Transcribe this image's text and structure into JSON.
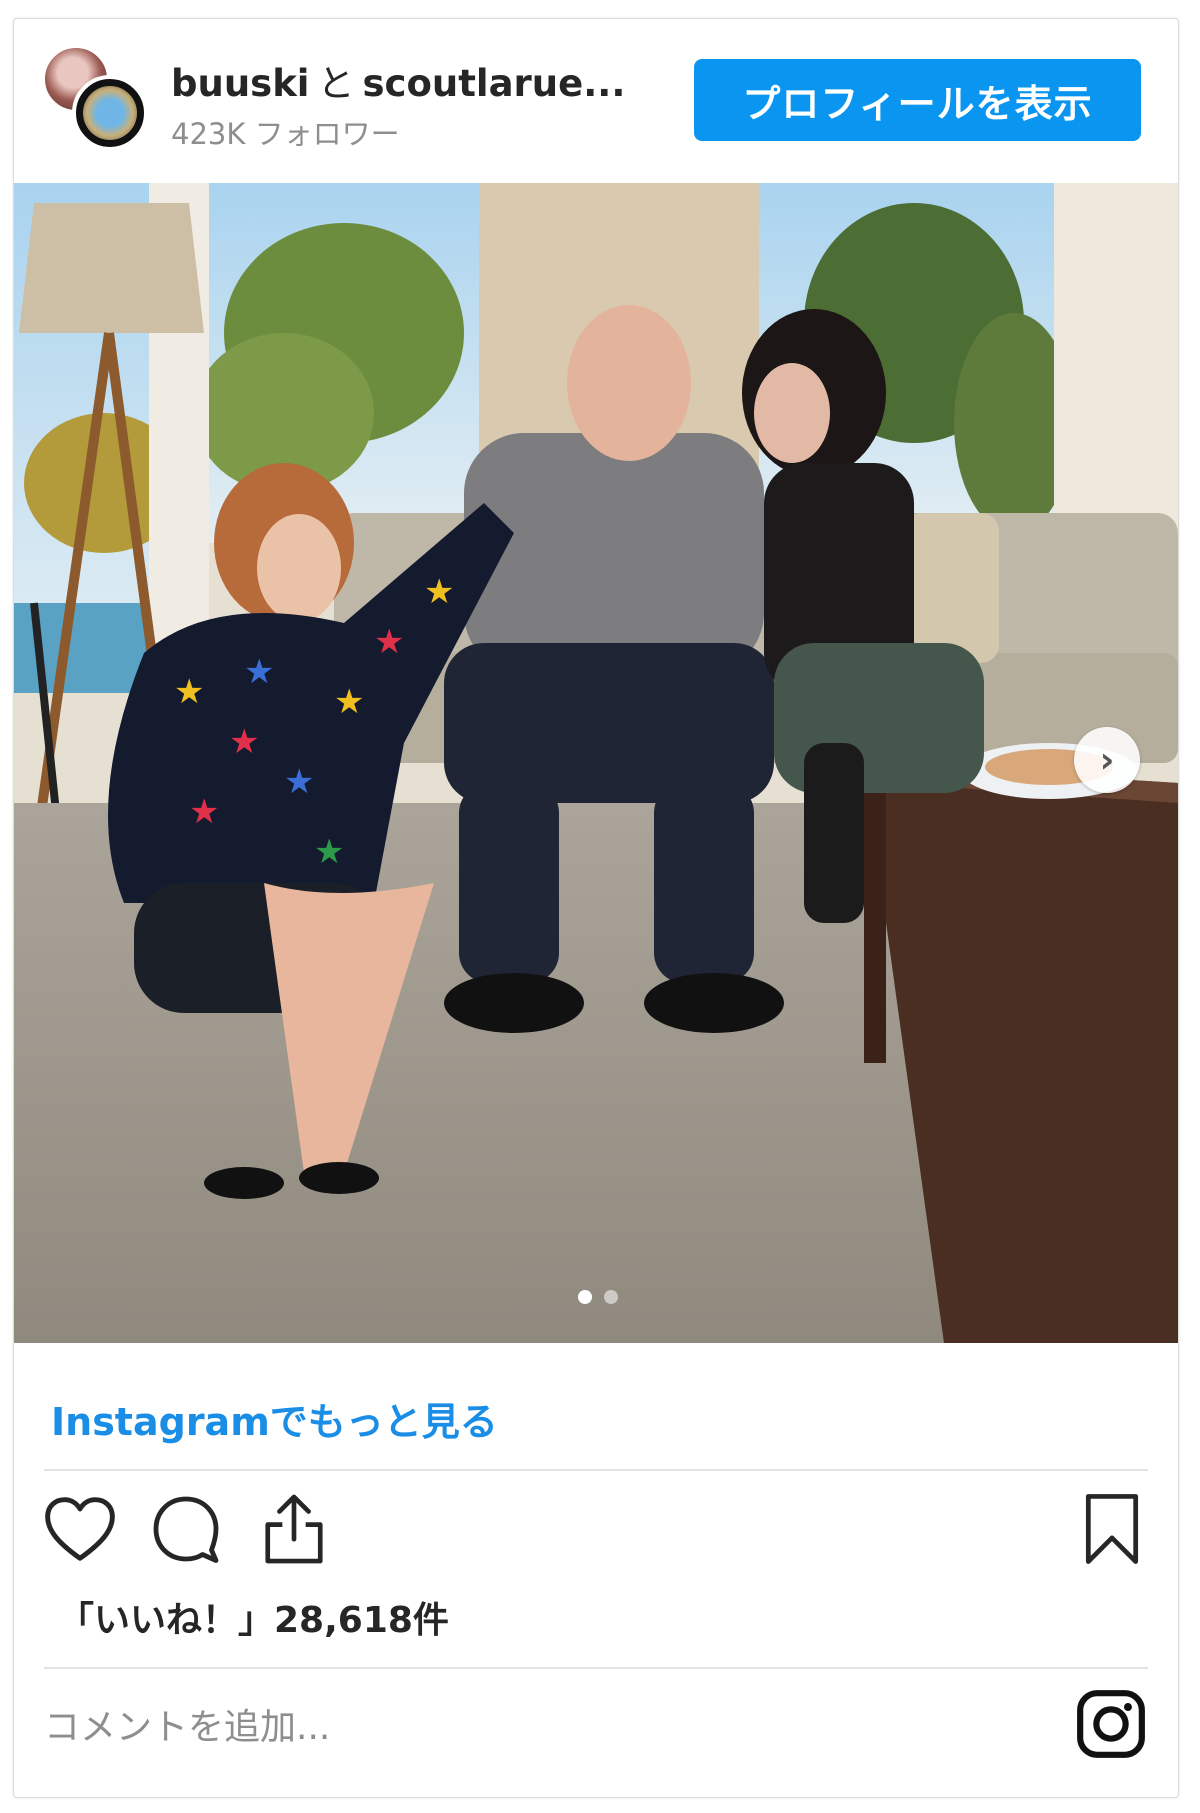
{
  "header": {
    "account_primary": "buuski",
    "connector": "と",
    "account_secondary": "scoutlarue...",
    "followers": "423K フォロワー",
    "view_profile_label": "プロフィールを表示"
  },
  "photo": {
    "icon_next": "chevron-right-icon",
    "carousel": {
      "count": 2,
      "active_index": 0
    }
  },
  "footer": {
    "more_link": "Instagramでもっと見る",
    "likes_text": "「いいね！」28,618件",
    "comment_placeholder": "コメントを追加...",
    "icons": [
      "heart-icon",
      "comment-icon",
      "share-icon",
      "bookmark-icon",
      "instagram-logo-icon"
    ]
  },
  "colors": {
    "accent": "#0a95f0",
    "link": "#1a8ee6",
    "text": "#262626",
    "muted": "#8e8e8e"
  }
}
